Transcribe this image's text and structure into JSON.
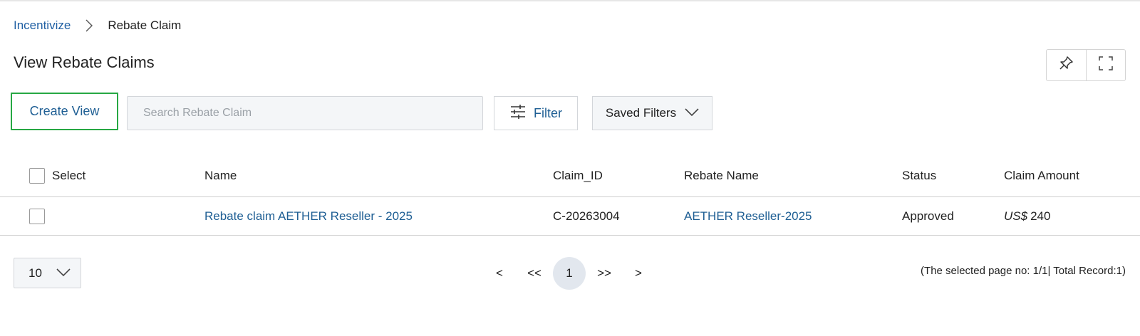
{
  "breadcrumb": {
    "root": "Incentivize",
    "current": "Rebate Claim"
  },
  "page": {
    "title": "View Rebate Claims"
  },
  "toolbar": {
    "create_view_label": "Create View",
    "search_placeholder": "Search Rebate Claim",
    "filter_label": "Filter",
    "saved_filters_label": "Saved Filters"
  },
  "table": {
    "columns": [
      "Select",
      "Name",
      "Claim_ID",
      "Rebate Name",
      "Status",
      "Claim Amount"
    ],
    "rows": [
      {
        "name": "Rebate claim AETHER Reseller - 2025",
        "claim_id": "C-20263004",
        "rebate_name": "AETHER Reseller-2025",
        "status": "Approved",
        "currency": "US$",
        "amount": "240"
      }
    ]
  },
  "pagination": {
    "page_size": "10",
    "prev": "<",
    "first": "<<",
    "current": "1",
    "last": ">>",
    "next": ">",
    "info": "(The selected page no: 1/1| Total Record:1)"
  },
  "colors": {
    "accent": "#1f5f94",
    "highlight_border": "#27a844"
  },
  "icons": [
    "chevron-right-icon",
    "pin-icon",
    "fullscreen-icon",
    "sliders-icon",
    "chevron-down-icon"
  ]
}
